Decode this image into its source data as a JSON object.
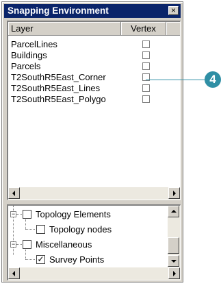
{
  "window": {
    "title": "Snapping Environment",
    "close_glyph": "×"
  },
  "layers_table": {
    "columns": [
      "Layer",
      "Vertex"
    ],
    "rows": [
      {
        "layer": "ParcelLines",
        "vertex": false
      },
      {
        "layer": "Buildings",
        "vertex": false
      },
      {
        "layer": "Parcels",
        "vertex": false
      },
      {
        "layer": "T2SouthR5East_Corner",
        "vertex": false
      },
      {
        "layer": "T2SouthR5East_Lines",
        "vertex": false
      },
      {
        "layer": "T2SouthR5East_Polygo",
        "vertex": false
      }
    ]
  },
  "tree": {
    "items": [
      {
        "label": "Topology Elements",
        "checked": false,
        "expander": "−"
      },
      {
        "label": "Topology nodes",
        "checked": false
      },
      {
        "label": "Miscellaneous",
        "checked": false,
        "expander": "−"
      },
      {
        "label": "Survey Points",
        "checked": true
      }
    ],
    "check_glyph": "✓"
  },
  "callout": {
    "number": "4"
  },
  "colors": {
    "titlebar": "#0a246a",
    "callout": "#2f8fa5",
    "face": "#d4d0c8"
  }
}
